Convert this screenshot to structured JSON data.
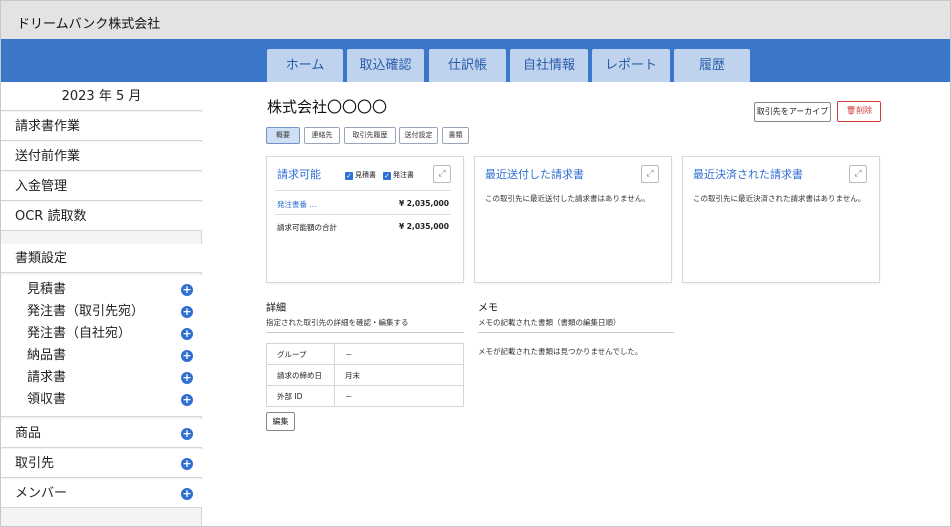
{
  "header": {
    "company": "ドリームバンク株式会社"
  },
  "nav": {
    "tabs": [
      {
        "label": "ホーム"
      },
      {
        "label": "取込確認"
      },
      {
        "label": "仕訳帳"
      },
      {
        "label": "自社情報"
      },
      {
        "label": "レポート"
      },
      {
        "label": "履歴"
      }
    ]
  },
  "sidebar": {
    "month": "2023 年 5 月",
    "items": [
      "請求書作業",
      "送付前作業",
      "入金管理",
      "OCR 読取数"
    ],
    "doc_settings": {
      "label": "書類設定",
      "subitems": [
        "見積書",
        "発注書（取引先宛）",
        "発注書（自社宛）",
        "納品書",
        "請求書",
        "領収書"
      ]
    },
    "bottom_items": [
      "商品",
      "取引先",
      "メンバー"
    ],
    "plus_icon": "+"
  },
  "main": {
    "title": "株式会社〇〇〇〇",
    "archive_button": "取引先をアーカイブ",
    "delete_button": "削除",
    "subtabs": [
      "概要",
      "連絡先",
      "取引先履歴",
      "送付設定",
      "書類"
    ],
    "cards": {
      "billable": {
        "title": "請求可能",
        "check_estimate": "見積書",
        "check_order": "発注書",
        "row1_label": "発注書番 ...",
        "row1_amount": "¥ 2,035,000",
        "row2_label": "請求可能額の合計",
        "row2_amount": "¥ 2,035,000"
      },
      "recent_sent": {
        "title": "最近送付した請求書",
        "empty": "この取引先に最近送付した請求書はありません。"
      },
      "recent_settled": {
        "title": "最近決済された請求書",
        "empty": "この取引先に最近決済された請求書はありません。"
      }
    },
    "detail": {
      "title": "詳細",
      "subtitle": "指定された取引先の詳細を確認・編集する",
      "rows": [
        {
          "key": "グループ",
          "value": "－"
        },
        {
          "key": "請求の締め日",
          "value": "月末"
        },
        {
          "key": "外部 ID",
          "value": "－"
        }
      ],
      "edit_button": "編集"
    },
    "memo": {
      "title": "メモ",
      "subtitle": "メモの記載された書類（書類の編集日順）",
      "empty": "メモが記載された書類は見つかりませんでした。"
    }
  },
  "colors": {
    "nav_blue": "#3a77c9",
    "tab_bg": "#bfd3ef",
    "accent": "#2f6fd1",
    "delete_red": "#d23a3a"
  }
}
